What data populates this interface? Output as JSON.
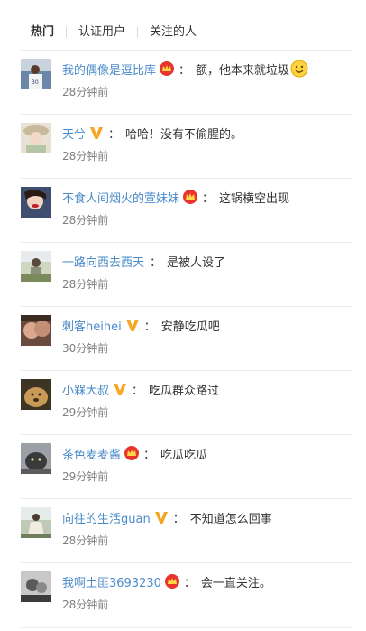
{
  "tabs": [
    {
      "label": "热门",
      "active": true
    },
    {
      "label": "认证用户",
      "active": false
    },
    {
      "label": "关注的人",
      "active": false
    }
  ],
  "comments": [
    {
      "user": "我的偶像是逗比库",
      "badge": "crown",
      "colon": "：",
      "text": "额，他本来就垃圾",
      "emoji": "smile",
      "time": "28分钟前",
      "avatar": "basketball-player-avatar"
    },
    {
      "user": "天兮",
      "badge": "v",
      "colon": "：",
      "text": "哈哈！没有不偷腥的。",
      "time": "28分钟前",
      "avatar": "girl-with-hat-avatar"
    },
    {
      "user": "不食人间烟火的萱妹妹",
      "badge": "crown",
      "colon": "：",
      "text": "这锅横空出现",
      "time": "28分钟前",
      "avatar": "woman-red-lips-avatar"
    },
    {
      "user": "一路向西去西天",
      "badge": "",
      "colon": "：",
      "text": "是被人设了",
      "time": "28分钟前",
      "avatar": "person-outdoor-avatar"
    },
    {
      "user": "刺客heihei",
      "badge": "v",
      "colon": "：",
      "text": "安静吃瓜吧",
      "time": "30分钟前",
      "avatar": "kiss-couple-avatar"
    },
    {
      "user": "小槑大叔",
      "badge": "v",
      "colon": "：",
      "text": "吃瓜群众路过",
      "time": "29分钟前",
      "avatar": "dog-avatar"
    },
    {
      "user": "茶色麦麦酱",
      "badge": "crown",
      "colon": "：",
      "text": "吃瓜吃瓜",
      "time": "29分钟前",
      "avatar": "dark-cat-avatar"
    },
    {
      "user": "向往的生活guan",
      "badge": "v",
      "colon": "：",
      "text": "不知道怎么回事",
      "time": "28分钟前",
      "avatar": "girl-dress-avatar"
    },
    {
      "user": "我啊土匪3693230",
      "badge": "crown",
      "colon": "：",
      "text": "会一直关注。",
      "time": "28分钟前",
      "avatar": "bw-photo-avatar"
    }
  ],
  "colors": {
    "username": "#4a8bc9",
    "time": "#808080",
    "v_badge": "#f6a623",
    "crown_badge": "#e8342c"
  }
}
